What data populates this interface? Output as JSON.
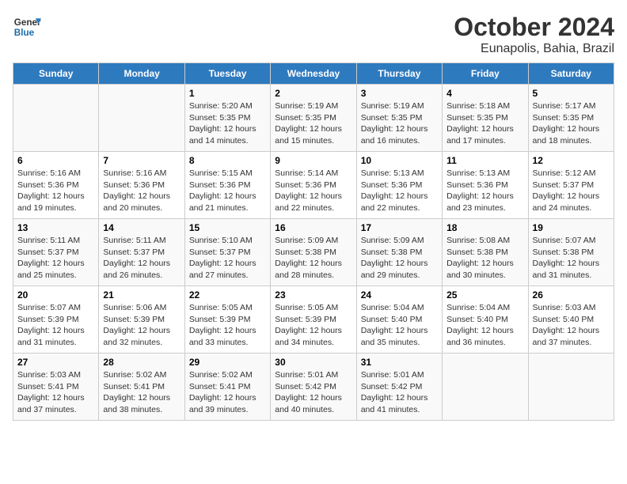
{
  "logo": {
    "line1": "General",
    "line2": "Blue"
  },
  "title": "October 2024",
  "subtitle": "Eunapolis, Bahia, Brazil",
  "days_header": [
    "Sunday",
    "Monday",
    "Tuesday",
    "Wednesday",
    "Thursday",
    "Friday",
    "Saturday"
  ],
  "weeks": [
    [
      {
        "day": "",
        "info": ""
      },
      {
        "day": "",
        "info": ""
      },
      {
        "day": "1",
        "info": "Sunrise: 5:20 AM\nSunset: 5:35 PM\nDaylight: 12 hours and 14 minutes."
      },
      {
        "day": "2",
        "info": "Sunrise: 5:19 AM\nSunset: 5:35 PM\nDaylight: 12 hours and 15 minutes."
      },
      {
        "day": "3",
        "info": "Sunrise: 5:19 AM\nSunset: 5:35 PM\nDaylight: 12 hours and 16 minutes."
      },
      {
        "day": "4",
        "info": "Sunrise: 5:18 AM\nSunset: 5:35 PM\nDaylight: 12 hours and 17 minutes."
      },
      {
        "day": "5",
        "info": "Sunrise: 5:17 AM\nSunset: 5:35 PM\nDaylight: 12 hours and 18 minutes."
      }
    ],
    [
      {
        "day": "6",
        "info": "Sunrise: 5:16 AM\nSunset: 5:36 PM\nDaylight: 12 hours and 19 minutes."
      },
      {
        "day": "7",
        "info": "Sunrise: 5:16 AM\nSunset: 5:36 PM\nDaylight: 12 hours and 20 minutes."
      },
      {
        "day": "8",
        "info": "Sunrise: 5:15 AM\nSunset: 5:36 PM\nDaylight: 12 hours and 21 minutes."
      },
      {
        "day": "9",
        "info": "Sunrise: 5:14 AM\nSunset: 5:36 PM\nDaylight: 12 hours and 22 minutes."
      },
      {
        "day": "10",
        "info": "Sunrise: 5:13 AM\nSunset: 5:36 PM\nDaylight: 12 hours and 22 minutes."
      },
      {
        "day": "11",
        "info": "Sunrise: 5:13 AM\nSunset: 5:36 PM\nDaylight: 12 hours and 23 minutes."
      },
      {
        "day": "12",
        "info": "Sunrise: 5:12 AM\nSunset: 5:37 PM\nDaylight: 12 hours and 24 minutes."
      }
    ],
    [
      {
        "day": "13",
        "info": "Sunrise: 5:11 AM\nSunset: 5:37 PM\nDaylight: 12 hours and 25 minutes."
      },
      {
        "day": "14",
        "info": "Sunrise: 5:11 AM\nSunset: 5:37 PM\nDaylight: 12 hours and 26 minutes."
      },
      {
        "day": "15",
        "info": "Sunrise: 5:10 AM\nSunset: 5:37 PM\nDaylight: 12 hours and 27 minutes."
      },
      {
        "day": "16",
        "info": "Sunrise: 5:09 AM\nSunset: 5:38 PM\nDaylight: 12 hours and 28 minutes."
      },
      {
        "day": "17",
        "info": "Sunrise: 5:09 AM\nSunset: 5:38 PM\nDaylight: 12 hours and 29 minutes."
      },
      {
        "day": "18",
        "info": "Sunrise: 5:08 AM\nSunset: 5:38 PM\nDaylight: 12 hours and 30 minutes."
      },
      {
        "day": "19",
        "info": "Sunrise: 5:07 AM\nSunset: 5:38 PM\nDaylight: 12 hours and 31 minutes."
      }
    ],
    [
      {
        "day": "20",
        "info": "Sunrise: 5:07 AM\nSunset: 5:39 PM\nDaylight: 12 hours and 31 minutes."
      },
      {
        "day": "21",
        "info": "Sunrise: 5:06 AM\nSunset: 5:39 PM\nDaylight: 12 hours and 32 minutes."
      },
      {
        "day": "22",
        "info": "Sunrise: 5:05 AM\nSunset: 5:39 PM\nDaylight: 12 hours and 33 minutes."
      },
      {
        "day": "23",
        "info": "Sunrise: 5:05 AM\nSunset: 5:39 PM\nDaylight: 12 hours and 34 minutes."
      },
      {
        "day": "24",
        "info": "Sunrise: 5:04 AM\nSunset: 5:40 PM\nDaylight: 12 hours and 35 minutes."
      },
      {
        "day": "25",
        "info": "Sunrise: 5:04 AM\nSunset: 5:40 PM\nDaylight: 12 hours and 36 minutes."
      },
      {
        "day": "26",
        "info": "Sunrise: 5:03 AM\nSunset: 5:40 PM\nDaylight: 12 hours and 37 minutes."
      }
    ],
    [
      {
        "day": "27",
        "info": "Sunrise: 5:03 AM\nSunset: 5:41 PM\nDaylight: 12 hours and 37 minutes."
      },
      {
        "day": "28",
        "info": "Sunrise: 5:02 AM\nSunset: 5:41 PM\nDaylight: 12 hours and 38 minutes."
      },
      {
        "day": "29",
        "info": "Sunrise: 5:02 AM\nSunset: 5:41 PM\nDaylight: 12 hours and 39 minutes."
      },
      {
        "day": "30",
        "info": "Sunrise: 5:01 AM\nSunset: 5:42 PM\nDaylight: 12 hours and 40 minutes."
      },
      {
        "day": "31",
        "info": "Sunrise: 5:01 AM\nSunset: 5:42 PM\nDaylight: 12 hours and 41 minutes."
      },
      {
        "day": "",
        "info": ""
      },
      {
        "day": "",
        "info": ""
      }
    ]
  ]
}
